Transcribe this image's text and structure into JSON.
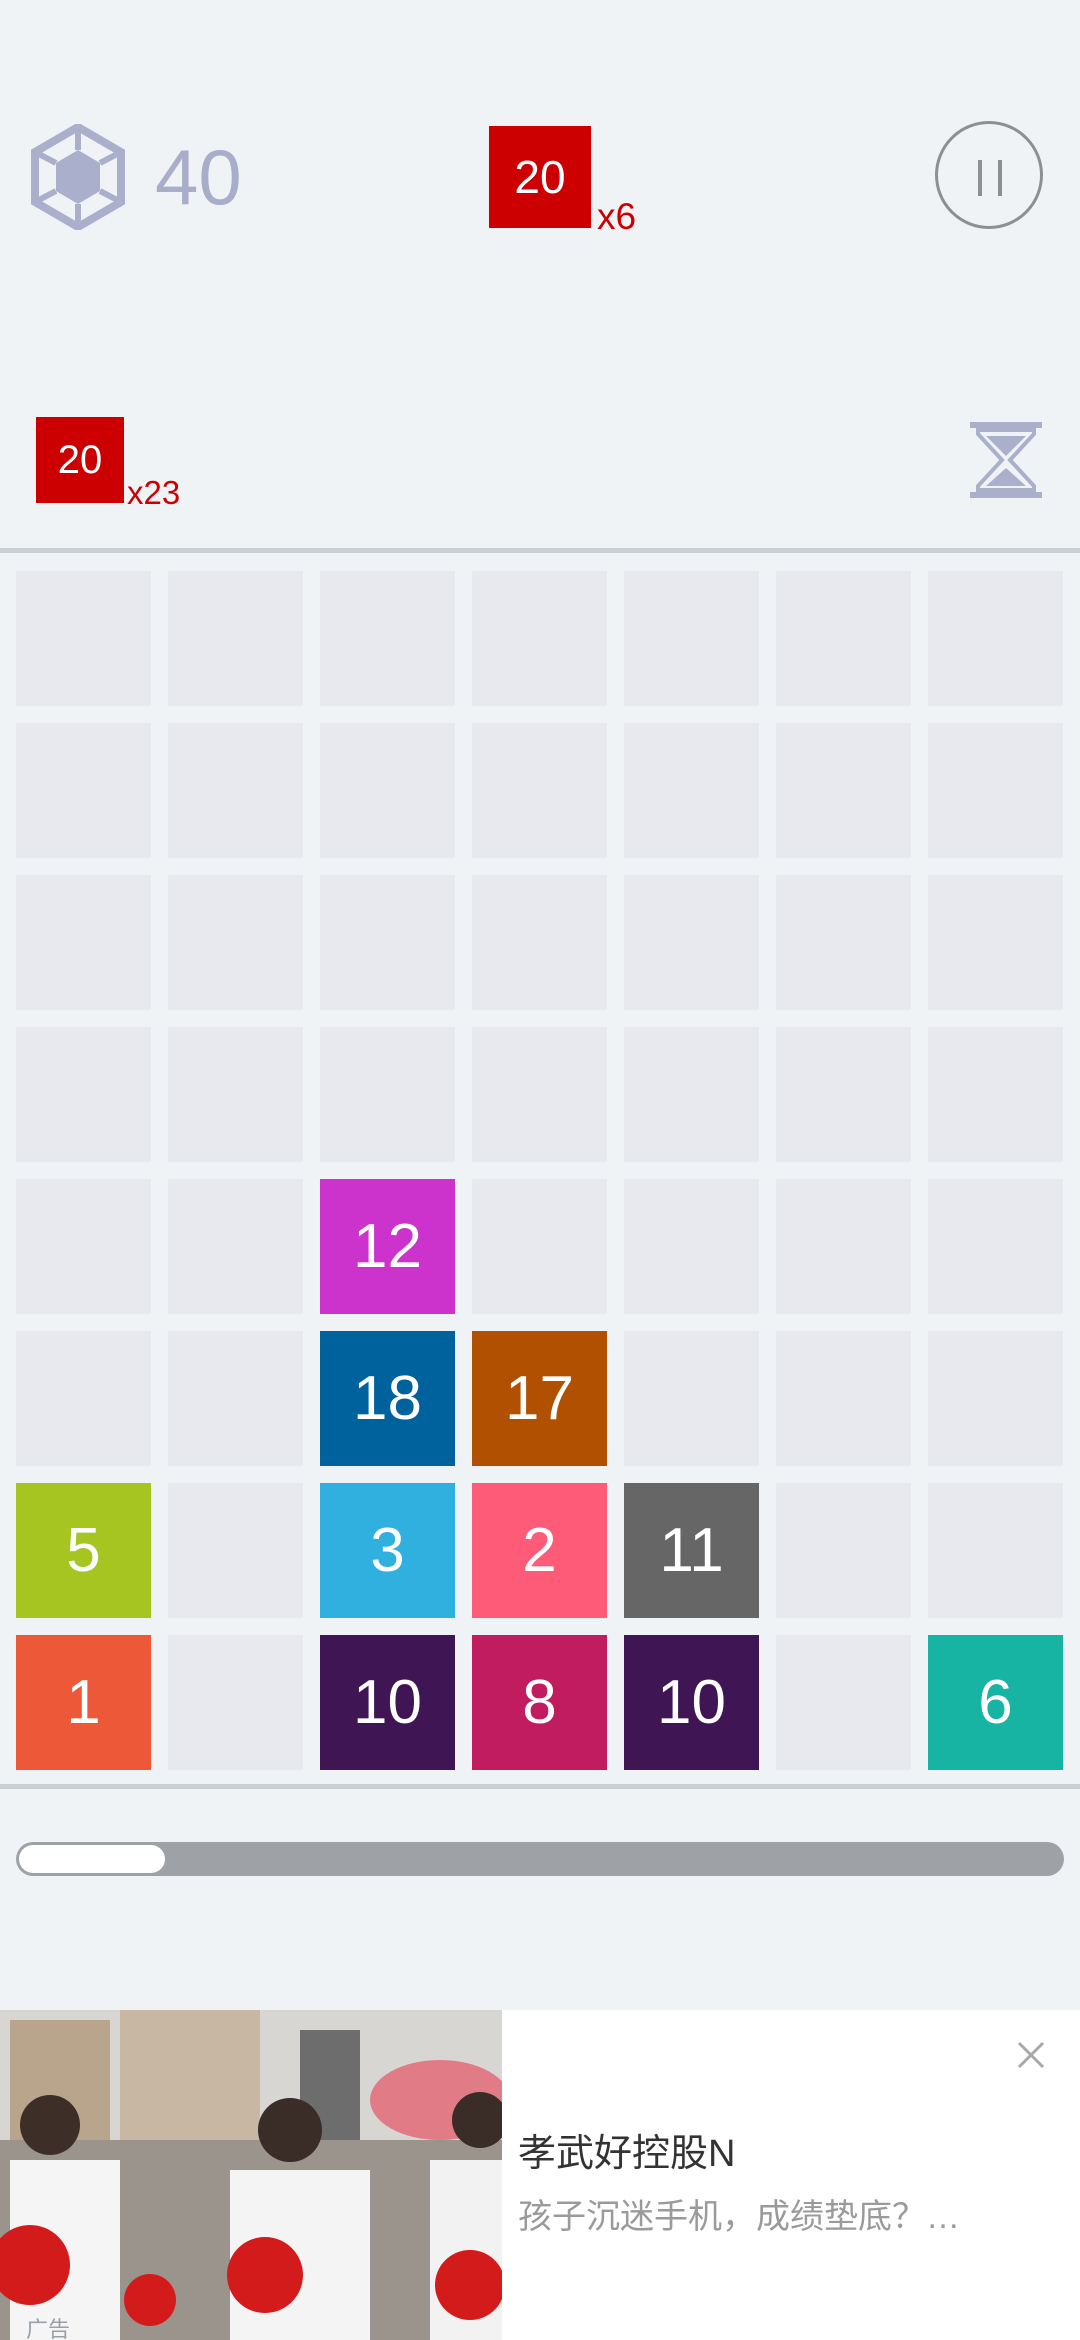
{
  "hud": {
    "gem_count": "40",
    "next_tile": {
      "value": "20",
      "multiplier": "x6",
      "color": "#cc0000"
    },
    "reserve_tile": {
      "value": "20",
      "multiplier": "x23",
      "color": "#cc0000"
    },
    "pause_icon": "pause-icon",
    "gem_icon": "hexagon-gem-icon",
    "timer_icon": "hourglass-icon"
  },
  "board": {
    "columns": 7,
    "rows": 8,
    "empty_color": "#e7e9ee",
    "tiles": [
      {
        "row": 4,
        "col": 2,
        "value": "12",
        "color": "#cc33cc"
      },
      {
        "row": 5,
        "col": 2,
        "value": "18",
        "color": "#00629d"
      },
      {
        "row": 5,
        "col": 3,
        "value": "17",
        "color": "#b05000"
      },
      {
        "row": 6,
        "col": 0,
        "value": "5",
        "color": "#a6c520"
      },
      {
        "row": 6,
        "col": 2,
        "value": "3",
        "color": "#2fb0de"
      },
      {
        "row": 6,
        "col": 3,
        "value": "2",
        "color": "#fd5b77"
      },
      {
        "row": 6,
        "col": 4,
        "value": "11",
        "color": "#666666"
      },
      {
        "row": 7,
        "col": 0,
        "value": "1",
        "color": "#ed5838"
      },
      {
        "row": 7,
        "col": 2,
        "value": "10",
        "color": "#3f1554"
      },
      {
        "row": 7,
        "col": 3,
        "value": "8",
        "color": "#c11c5f"
      },
      {
        "row": 7,
        "col": 4,
        "value": "10",
        "color": "#3f1554"
      },
      {
        "row": 7,
        "col": 6,
        "value": "6",
        "color": "#17b3a3"
      }
    ]
  },
  "progress": {
    "fraction": 0.14
  },
  "ad": {
    "label": "广告",
    "title": "孝武好控股N",
    "description": "孩子沉迷手机，成绩垫底？…",
    "close_icon": "close-icon"
  }
}
